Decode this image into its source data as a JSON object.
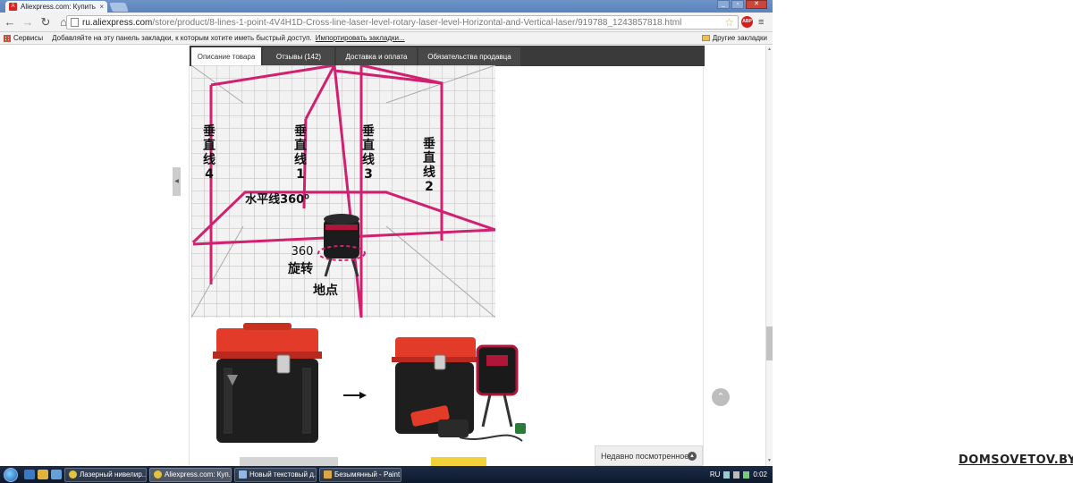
{
  "browser": {
    "tab_title": "Aliexpress.com: Купить 2(",
    "tab_close": "×",
    "url_host": "ru.aliexpress.com",
    "url_path": "/store/product/8-lines-1-point-4V4H1D-Cross-line-laser-level-rotary-laser-level-Horizontal-and-Vertical-laser/919788_1243857818.html"
  },
  "bookmarks": {
    "apps_label": "Сервисы",
    "hint": "Добавляйте на эту панель закладки, к которым хотите иметь быстрый доступ.",
    "import_link": "Импортировать закладки...",
    "other_label": "Другие закладки"
  },
  "product_tabs": [
    {
      "label": "Описание товара"
    },
    {
      "label": "Отзывы (142)"
    },
    {
      "label": "Доставка и оплата"
    },
    {
      "label": "Обязательства продавца"
    }
  ],
  "laser_image": {
    "v4": [
      "垂",
      "直",
      "线",
      "4"
    ],
    "v1": [
      "垂",
      "直",
      "线",
      "1"
    ],
    "v3": [
      "垂",
      "直",
      "线",
      "3"
    ],
    "v2": [
      "垂",
      "直",
      "线",
      "2"
    ],
    "horizontal": "水平线360⁰",
    "rot_num": "360",
    "rot_label": "旋转",
    "ground": "地点"
  },
  "recently_viewed": "Недавно посмотренное",
  "taskbar": {
    "items": [
      {
        "label": "Лазерный нивелир..."
      },
      {
        "label": "Aliexpress.com: Куп..."
      },
      {
        "label": "Новый текстовый д..."
      },
      {
        "label": "Безымянный - Paint"
      }
    ],
    "lang": "RU",
    "time": "0:02"
  },
  "watermark": "DOMSOVETOV.BY",
  "colors": {
    "laser": "#d0206f",
    "tab_bar": "#3a3a3a",
    "case_red": "#e23b2a"
  }
}
